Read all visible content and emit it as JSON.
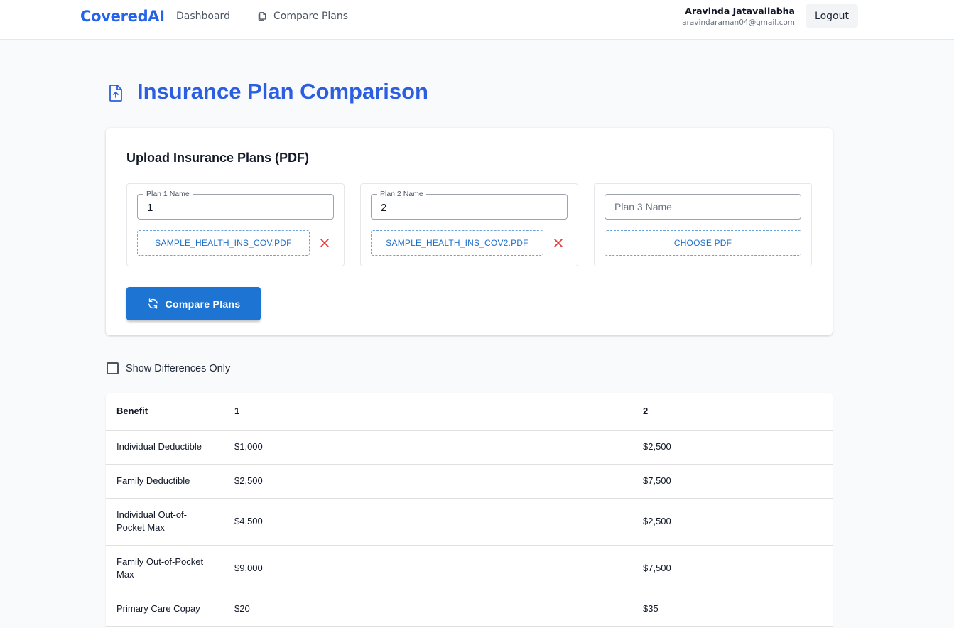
{
  "nav": {
    "brand": "CoveredAI",
    "dashboard": "Dashboard",
    "compare_plans": "Compare Plans",
    "user_name": "Aravinda Jatavallabha",
    "user_email": "aravindaraman04@gmail.com",
    "logout": "Logout"
  },
  "page": {
    "title": "Insurance Plan Comparison"
  },
  "upload": {
    "title": "Upload Insurance Plans (PDF)",
    "plans": [
      {
        "label": "Plan 1 Name",
        "value": "1",
        "file": "SAMPLE_HEALTH_INS_COV.PDF"
      },
      {
        "label": "Plan 2 Name",
        "value": "2",
        "file": "SAMPLE_HEALTH_INS_COV2.PDF"
      },
      {
        "placeholder": "Plan 3 Name",
        "file": "CHOOSE PDF"
      }
    ],
    "compare_button": "Compare Plans"
  },
  "filter": {
    "show_differences": "Show Differences Only",
    "checked": false
  },
  "table": {
    "headers": [
      "Benefit",
      "1",
      "2"
    ],
    "rows": [
      [
        "Individual Deductible",
        "$1,000",
        "$2,500"
      ],
      [
        "Family Deductible",
        "$2,500",
        "$7,500"
      ],
      [
        "Individual Out-of-Pocket Max",
        "$4,500",
        "$2,500"
      ],
      [
        "Family Out-of-Pocket Max",
        "$9,000",
        "$7,500"
      ],
      [
        "Primary Care Copay",
        "$20",
        "$35"
      ]
    ]
  },
  "colors": {
    "brand": "#2563eb",
    "title": "#2b5fe0",
    "primary_button": "#1e74d2",
    "remove": "#e53935"
  }
}
